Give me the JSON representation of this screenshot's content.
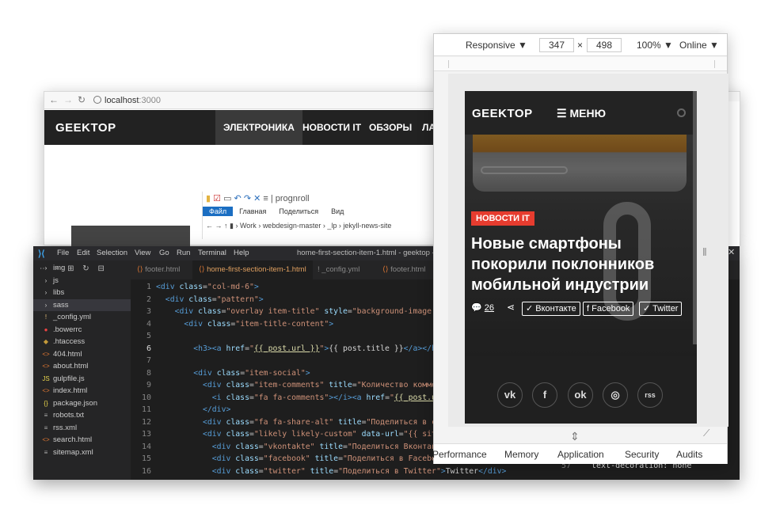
{
  "browser": {
    "url_host": "localhost",
    "url_port": ":3000",
    "logo": "GEEKTOP",
    "menu": [
      "ЭЛЕКТРОНИКА",
      "НОВОСТИ IT",
      "ОБЗОРЫ",
      "ЛА"
    ]
  },
  "explorer": {
    "title": "prognroll",
    "ribbon": [
      "Файл",
      "Главная",
      "Поделиться",
      "Вид"
    ],
    "path": [
      "Work",
      "webdesign-master",
      "_lp",
      "jekyll-news-site"
    ]
  },
  "vscode": {
    "menu": [
      "File",
      "Edit",
      "Selection",
      "View",
      "Go",
      "Run",
      "Terminal",
      "Help"
    ],
    "window_title": "home-first-section-item-1.html - geektop - Visi",
    "tabs": [
      "footer.html",
      "home-first-section-item-1.html",
      "_config.yml",
      "footer.html"
    ],
    "files": [
      {
        "icon": "›",
        "name": "img"
      },
      {
        "icon": "›",
        "name": "js"
      },
      {
        "icon": "›",
        "name": "libs"
      },
      {
        "icon": "›",
        "name": "sass"
      },
      {
        "icon": "!",
        "name": "_config.yml"
      },
      {
        "icon": "●",
        "name": ".bowerrc"
      },
      {
        "icon": "◆",
        "name": ".htaccess"
      },
      {
        "icon": "<>",
        "name": "404.html"
      },
      {
        "icon": "<>",
        "name": "about.html"
      },
      {
        "icon": "JS",
        "name": "gulpfile.js"
      },
      {
        "icon": "<>",
        "name": "index.html"
      },
      {
        "icon": "{}",
        "name": "package.json"
      },
      {
        "icon": "≡",
        "name": "robots.txt"
      },
      {
        "icon": "≡",
        "name": "rss.xml"
      },
      {
        "icon": "<>",
        "name": "search.html"
      },
      {
        "icon": "≡",
        "name": "sitemap.xml"
      }
    ],
    "line_numbers": [
      "1",
      "2",
      "3",
      "4",
      "5",
      "6",
      "7",
      "8",
      "9",
      "10",
      "11",
      "12",
      "13",
      "14",
      "15",
      "16"
    ],
    "right_code": {
      "line": "57",
      "text": "text-decoration: none"
    }
  },
  "devtools": {
    "device": "Responsive",
    "width": "347",
    "times": "×",
    "height": "498",
    "zoom": "100%",
    "network": "Online",
    "tabs": [
      "Performance",
      "Memory",
      "Application",
      "Security",
      "Audits"
    ]
  },
  "phone": {
    "logo": "GEEKTOP",
    "menu": "МЕНЮ",
    "badge": "НОВОСТИ IT",
    "title": "Новые смартфоны покорили поклонников мобильной индустрии",
    "comments": "26",
    "share": [
      "Вконтакте",
      "Facebook",
      "Twitter"
    ],
    "social": [
      "vk",
      "f",
      "ok",
      "◎",
      "rss"
    ]
  }
}
